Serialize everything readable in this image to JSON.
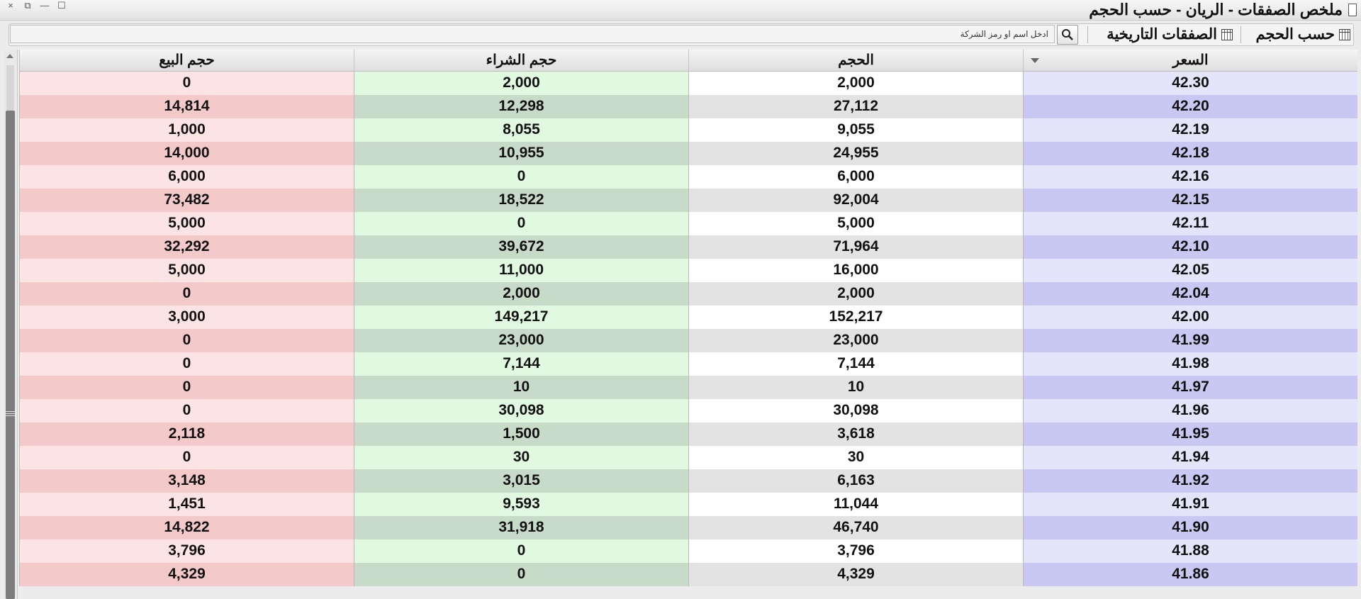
{
  "window": {
    "title": "ملخص الصفقات - الريان - حسب الحجم",
    "controls": [
      "×",
      "⧉",
      "—",
      "☐"
    ]
  },
  "toolbar": {
    "by_volume_label": "حسب الحجم",
    "historical_label": "الصفقات التاريخية",
    "search_placeholder": "ادخل اسم او رمز الشركة"
  },
  "table": {
    "columns": {
      "price": "السعر",
      "volume": "الحجم",
      "buy_volume": "حجم الشراء",
      "sell_volume": "حجم البيع"
    },
    "rows": [
      {
        "price": "42.30",
        "volume": "2,000",
        "buy": "2,000",
        "sell": "0"
      },
      {
        "price": "42.20",
        "volume": "27,112",
        "buy": "12,298",
        "sell": "14,814"
      },
      {
        "price": "42.19",
        "volume": "9,055",
        "buy": "8,055",
        "sell": "1,000"
      },
      {
        "price": "42.18",
        "volume": "24,955",
        "buy": "10,955",
        "sell": "14,000"
      },
      {
        "price": "42.16",
        "volume": "6,000",
        "buy": "0",
        "sell": "6,000"
      },
      {
        "price": "42.15",
        "volume": "92,004",
        "buy": "18,522",
        "sell": "73,482"
      },
      {
        "price": "42.11",
        "volume": "5,000",
        "buy": "0",
        "sell": "5,000"
      },
      {
        "price": "42.10",
        "volume": "71,964",
        "buy": "39,672",
        "sell": "32,292"
      },
      {
        "price": "42.05",
        "volume": "16,000",
        "buy": "11,000",
        "sell": "5,000"
      },
      {
        "price": "42.04",
        "volume": "2,000",
        "buy": "2,000",
        "sell": "0"
      },
      {
        "price": "42.00",
        "volume": "152,217",
        "buy": "149,217",
        "sell": "3,000"
      },
      {
        "price": "41.99",
        "volume": "23,000",
        "buy": "23,000",
        "sell": "0"
      },
      {
        "price": "41.98",
        "volume": "7,144",
        "buy": "7,144",
        "sell": "0"
      },
      {
        "price": "41.97",
        "volume": "10",
        "buy": "10",
        "sell": "0"
      },
      {
        "price": "41.96",
        "volume": "30,098",
        "buy": "30,098",
        "sell": "0"
      },
      {
        "price": "41.95",
        "volume": "3,618",
        "buy": "1,500",
        "sell": "2,118"
      },
      {
        "price": "41.94",
        "volume": "30",
        "buy": "30",
        "sell": "0"
      },
      {
        "price": "41.92",
        "volume": "6,163",
        "buy": "3,015",
        "sell": "3,148"
      },
      {
        "price": "41.91",
        "volume": "11,044",
        "buy": "9,593",
        "sell": "1,451"
      },
      {
        "price": "41.90",
        "volume": "46,740",
        "buy": "31,918",
        "sell": "14,822"
      },
      {
        "price": "41.88",
        "volume": "3,796",
        "buy": "0",
        "sell": "3,796"
      },
      {
        "price": "41.86",
        "volume": "4,329",
        "buy": "0",
        "sell": "4,329"
      }
    ]
  },
  "colors": {
    "sell_light": "#fde4e4",
    "sell_dark": "#f3c9c9",
    "buy_light": "#e1f8e1",
    "buy_dark": "#c8dac8",
    "price_light": "#e4e4fb",
    "price_dark": "#c8c8f3"
  }
}
